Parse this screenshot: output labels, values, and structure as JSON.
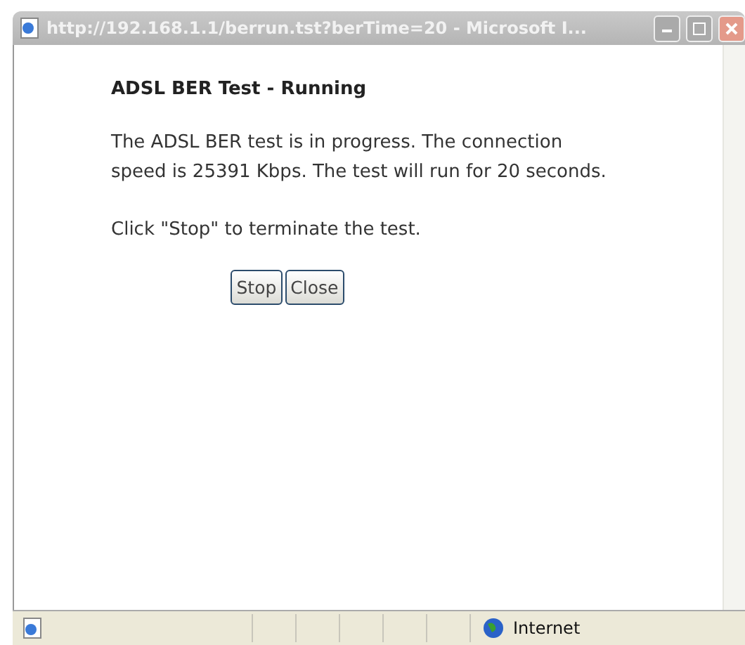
{
  "window": {
    "title": "http://192.168.1.1/berrun.tst?berTime=20 - Microsoft I..."
  },
  "page": {
    "heading": "ADSL BER Test - Running",
    "paragraphs": [
      "The ADSL BER test is in progress. The connection speed is 25391 Kbps. The test will run for 20 seconds.",
      "Click \"Stop\" to terminate the test."
    ],
    "buttons": [
      "Stop",
      "Close"
    ]
  },
  "status_bar": {
    "zone": "Internet"
  }
}
